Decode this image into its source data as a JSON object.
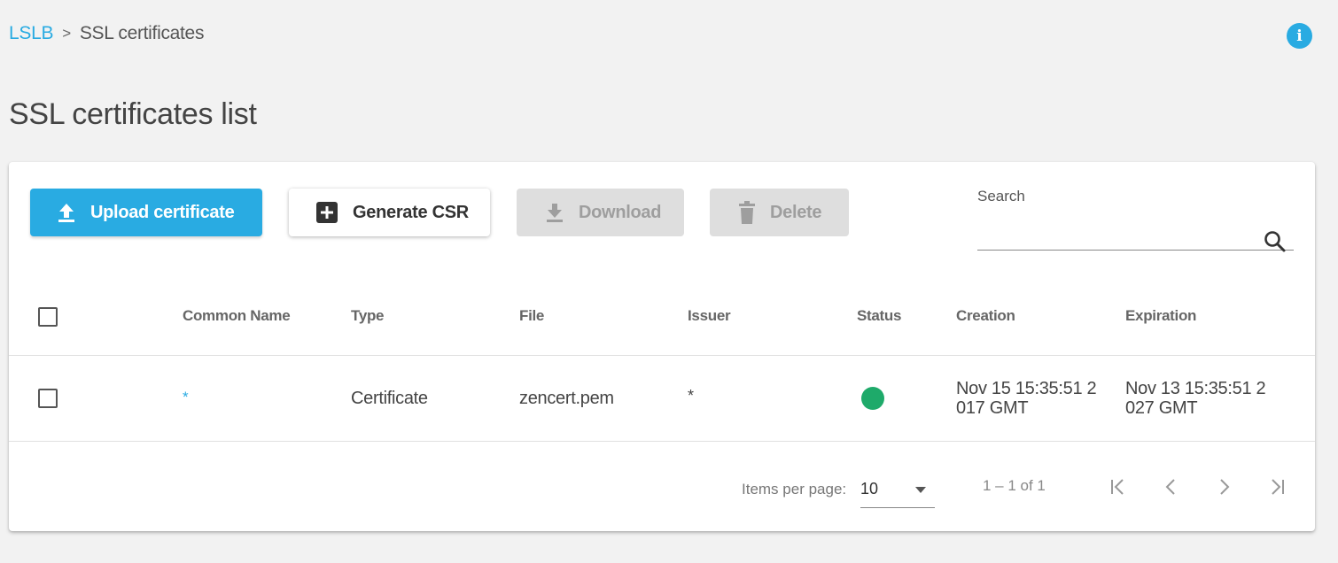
{
  "breadcrumb": {
    "root": "LSLB",
    "separator": ">",
    "current": "SSL certificates"
  },
  "page_title": "SSL certificates list",
  "toolbar": {
    "upload_label": "Upload certificate",
    "csr_label": "Generate CSR",
    "download_label": "Download",
    "delete_label": "Delete"
  },
  "search": {
    "label": "Search",
    "value": ""
  },
  "table": {
    "headers": {
      "common_name": "Common Name",
      "type": "Type",
      "file": "File",
      "issuer": "Issuer",
      "status": "Status",
      "creation": "Creation",
      "expiration": "Expiration"
    },
    "rows": [
      {
        "common_name": "*",
        "type": "Certificate",
        "file": "zencert.pem",
        "issuer": "*",
        "status": "active",
        "creation_line1": "Nov 15 15:35:51 2",
        "creation_line2": "017 GMT",
        "expiration_line1": "Nov 13 15:35:51 2",
        "expiration_line2": "027 GMT"
      }
    ]
  },
  "paginator": {
    "items_per_page_label": "Items per page:",
    "items_per_page_value": "10",
    "range_label": "1 – 1 of 1"
  },
  "colors": {
    "accent": "#29abe2",
    "status_ok": "#1eaa6a",
    "disabled_bg": "#dedede"
  }
}
